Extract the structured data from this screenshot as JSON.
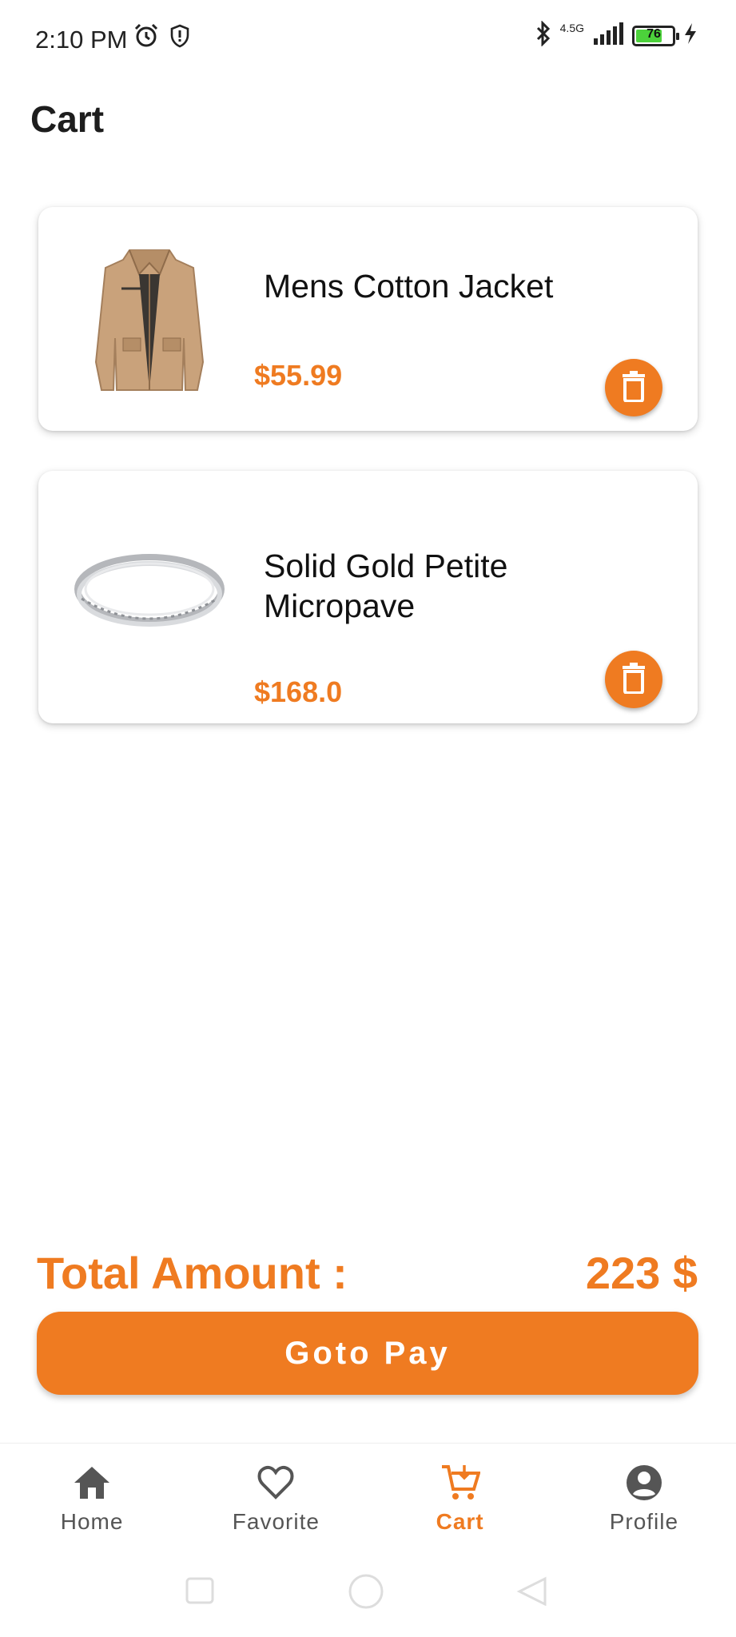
{
  "status_bar": {
    "time": "2:10 PM",
    "network": "4.5G",
    "battery": "76",
    "battery_level": 0.76
  },
  "page": {
    "title": "Cart"
  },
  "cart": {
    "items": [
      {
        "name": "Mens Cotton Jacket",
        "price": "$55.99",
        "image_icon": "jacket-image"
      },
      {
        "name": "Solid Gold Petite Micropave",
        "price": "$168.0",
        "image_icon": "ring-image"
      }
    ]
  },
  "summary": {
    "total_label": "Total Amount :",
    "total_value": "223 $",
    "pay_label": "Goto Pay"
  },
  "bottom_nav": {
    "items": [
      {
        "label": "Home",
        "icon": "home-icon",
        "active": false
      },
      {
        "label": "Favorite",
        "icon": "heart-icon",
        "active": false
      },
      {
        "label": "Cart",
        "icon": "cart-icon",
        "active": true
      },
      {
        "label": "Profile",
        "icon": "profile-icon",
        "active": false
      }
    ]
  },
  "colors": {
    "accent": "#ef7b21",
    "text": "#1a1a1a",
    "inactive": "#555555"
  }
}
